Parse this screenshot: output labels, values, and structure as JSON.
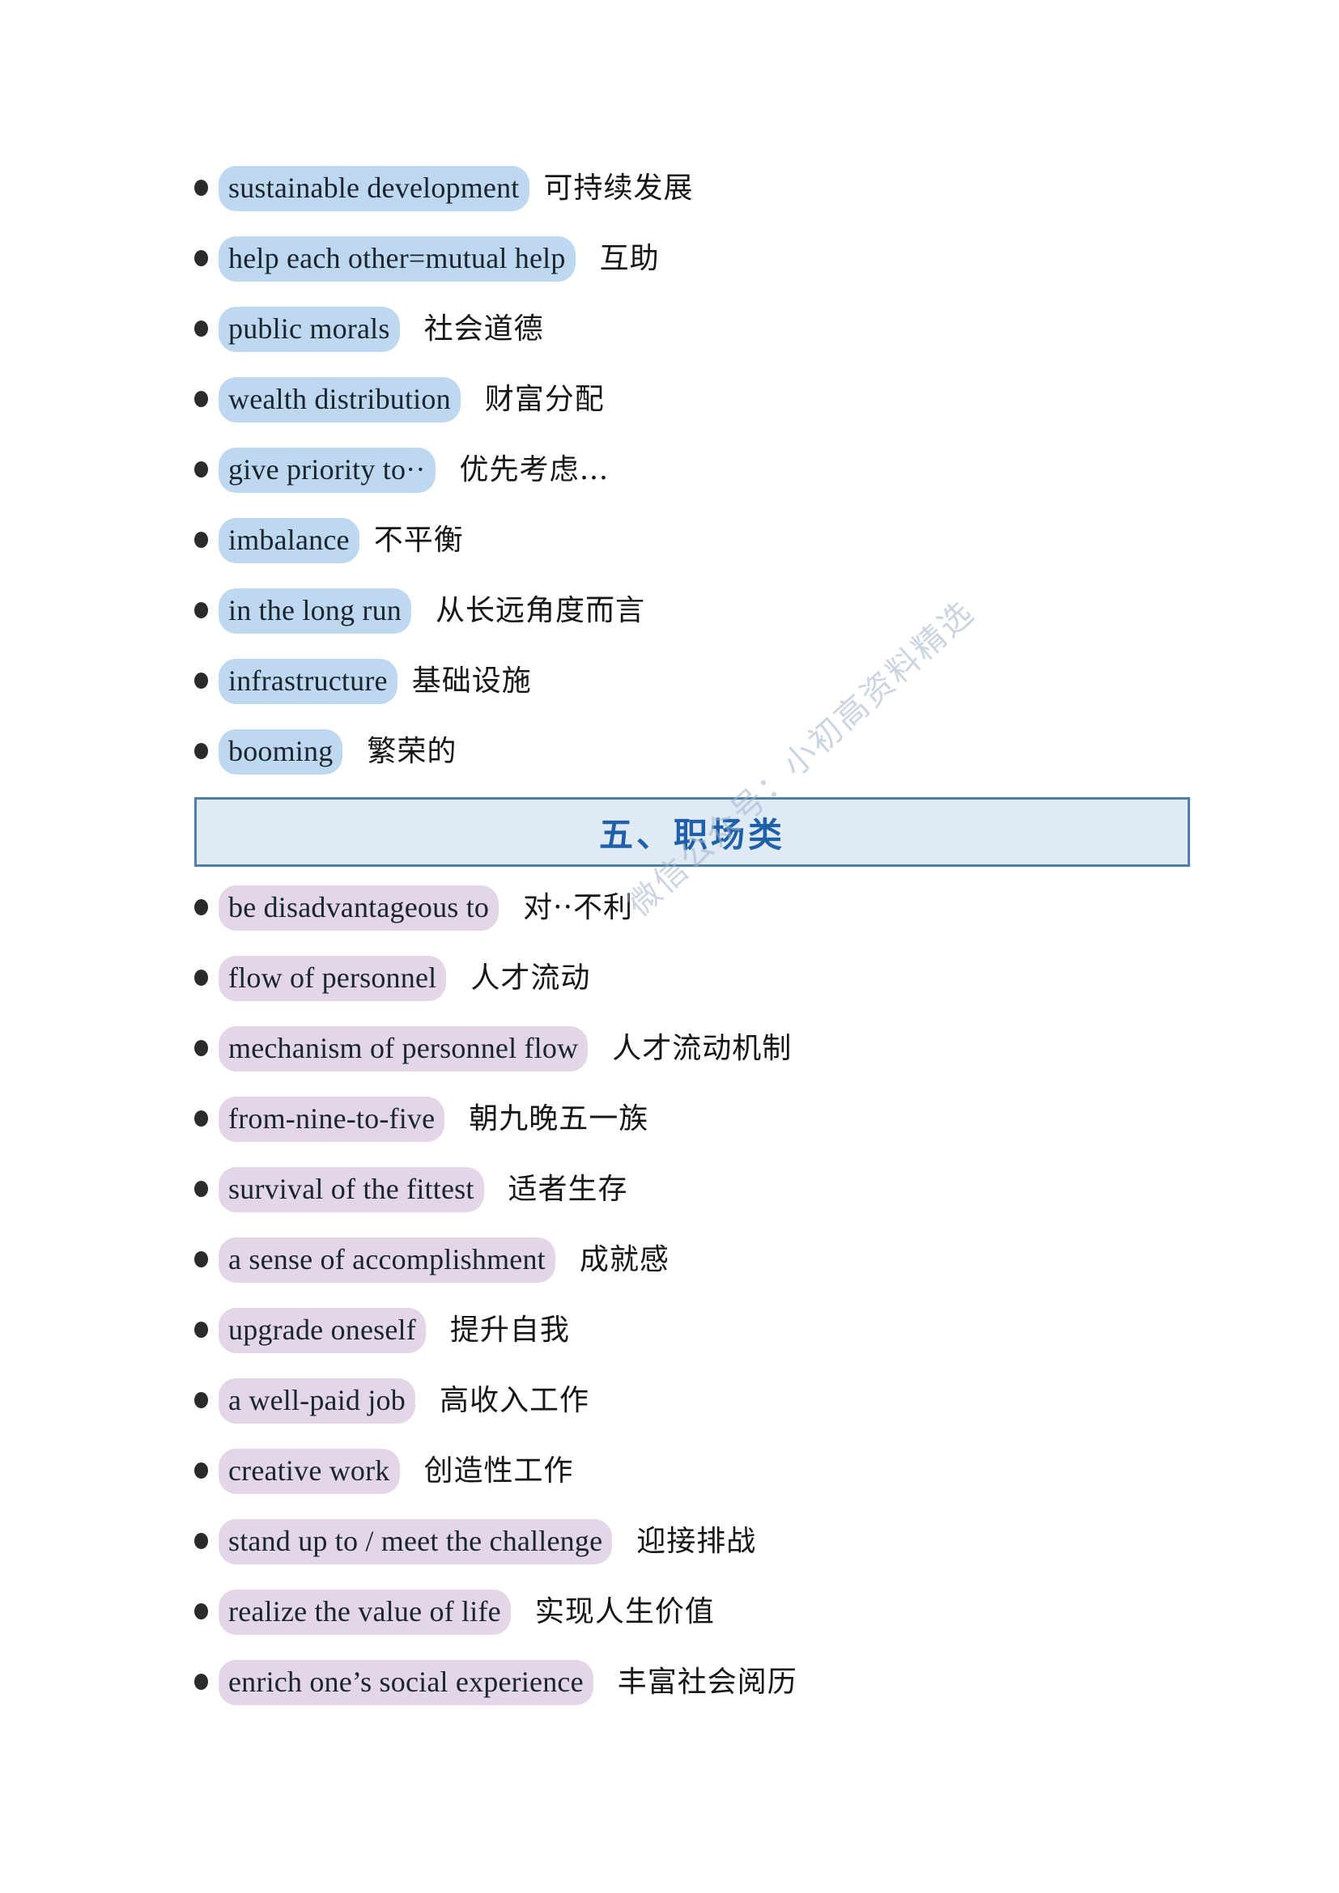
{
  "document": {
    "watermark": "微信公众号：小初高资料精选"
  },
  "blocks": [
    {
      "kind": "item",
      "highlight": "blue",
      "en": "sustainable development",
      "zh": "可持续发展",
      "gap": "sm"
    },
    {
      "kind": "item",
      "highlight": "blue",
      "en": "help each other=mutual help",
      "zh": "互助",
      "gap": "md"
    },
    {
      "kind": "item",
      "highlight": "blue",
      "en": "public morals",
      "zh": "社会道德",
      "gap": "md"
    },
    {
      "kind": "item",
      "highlight": "blue",
      "en": "wealth distribution",
      "zh": "财富分配",
      "gap": "md"
    },
    {
      "kind": "item",
      "highlight": "blue",
      "en": "give priority to··",
      "zh": "优先考虑…",
      "gap": "md"
    },
    {
      "kind": "item",
      "highlight": "blue",
      "en": "imbalance",
      "zh": "不平衡",
      "gap": "sm"
    },
    {
      "kind": "item",
      "highlight": "blue",
      "en": "in the long run",
      "zh": "从长远角度而言",
      "gap": "md"
    },
    {
      "kind": "item",
      "highlight": "blue",
      "en": "infrastructure",
      "zh": "基础设施",
      "gap": "sm"
    },
    {
      "kind": "item",
      "highlight": "blue",
      "en": "booming",
      "zh": "繁荣的",
      "gap": "md"
    },
    {
      "kind": "section",
      "title": "五、职场类"
    },
    {
      "kind": "item",
      "highlight": "purple",
      "en": "be disadvantageous to",
      "zh": "对··不利",
      "gap": "md"
    },
    {
      "kind": "item",
      "highlight": "purple",
      "en": "flow of personnel",
      "zh": "人才流动",
      "gap": "md"
    },
    {
      "kind": "item",
      "highlight": "purple",
      "en": "mechanism of personnel flow",
      "zh": "人才流动机制",
      "gap": "md"
    },
    {
      "kind": "item",
      "highlight": "purple",
      "en": "from-nine-to-five",
      "zh": "朝九晚五一族",
      "gap": "md"
    },
    {
      "kind": "item",
      "highlight": "purple",
      "en": "survival of the fittest",
      "zh": "适者生存",
      "gap": "md"
    },
    {
      "kind": "item",
      "highlight": "purple",
      "en": "a sense of accomplishment",
      "zh": "成就感",
      "gap": "md"
    },
    {
      "kind": "item",
      "highlight": "purple",
      "en": "upgrade oneself",
      "zh": "提升自我",
      "gap": "md"
    },
    {
      "kind": "item",
      "highlight": "purple",
      "en": "a well-paid job",
      "zh": "高收入工作",
      "gap": "md"
    },
    {
      "kind": "item",
      "highlight": "purple",
      "en": "creative work",
      "zh": "创造性工作",
      "gap": "md"
    },
    {
      "kind": "item",
      "highlight": "purple",
      "en": "stand up to / meet the challenge",
      "zh": "迎接排战",
      "gap": "md"
    },
    {
      "kind": "item",
      "highlight": "purple",
      "en": "realize the value of life",
      "zh": "实现人生价值",
      "gap": "md"
    },
    {
      "kind": "item",
      "highlight": "purple",
      "en": "enrich one’s social experience",
      "zh": "丰富社会阅历",
      "gap": "md"
    }
  ],
  "colors": {
    "highlight_blue": "#bed9ef",
    "highlight_purple": "#e3d6e6",
    "banner_fill": "#dfeaf4",
    "banner_border": "#4d7fa6",
    "banner_text": "#2060a8",
    "watermark": "#9fb4c9"
  }
}
